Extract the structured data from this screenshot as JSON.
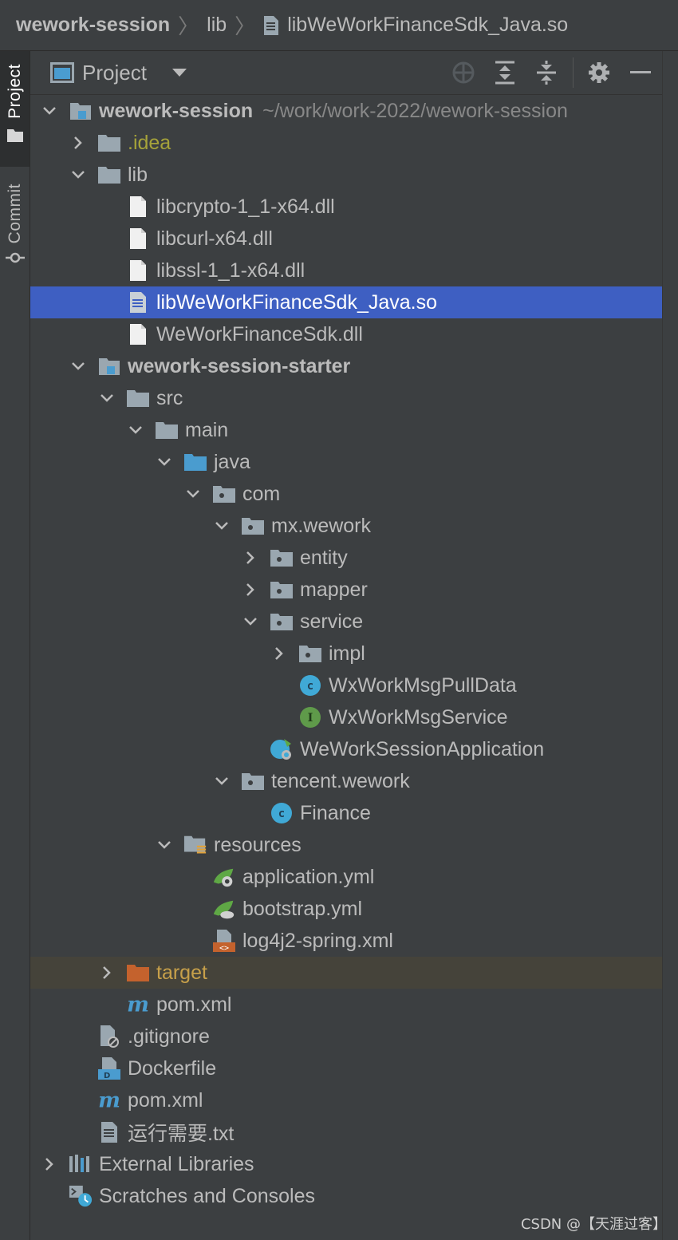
{
  "breadcrumb": {
    "root": "wework-session",
    "folder": "lib",
    "file": "libWeWorkFinanceSdk_Java.so"
  },
  "stripe": {
    "project_label": "Project",
    "commit_label": "Commit"
  },
  "panel": {
    "title": "Project",
    "dropdown_icon": "chevron-down-icon",
    "actions": [
      "locate-icon",
      "expand-all-icon",
      "collapse-all-icon",
      "gear-icon",
      "minimize-icon"
    ]
  },
  "tree": {
    "root": {
      "name": "wework-session",
      "path": "~/work/work-2022/wework-session"
    },
    "idea": ".idea",
    "lib": "lib",
    "lib_files": [
      "libcrypto-1_1-x64.dll",
      "libcurl-x64.dll",
      "libssl-1_1-x64.dll",
      "libWeWorkFinanceSdk_Java.so",
      "WeWorkFinanceSdk.dll"
    ],
    "starter": "wework-session-starter",
    "src": "src",
    "main": "main",
    "java": "java",
    "com": "com",
    "mx_wework": "mx.wework",
    "entity": "entity",
    "mapper": "mapper",
    "service": "service",
    "impl": "impl",
    "pull_data": "WxWorkMsgPullData",
    "msg_service": "WxWorkMsgService",
    "app": "WeWorkSessionApplication",
    "tencent_wework": "tencent.wework",
    "finance": "Finance",
    "resources": "resources",
    "app_yml": "application.yml",
    "bootstrap_yml": "bootstrap.yml",
    "log4j": "log4j2-spring.xml",
    "target": "target",
    "starter_pom": "pom.xml",
    "gitignore": ".gitignore",
    "dockerfile": "Dockerfile",
    "root_pom": "pom.xml",
    "txt": "运行需要.txt",
    "external_libraries": "External Libraries",
    "scratches": "Scratches and Consoles"
  },
  "watermark": "CSDN @【天涯过客】",
  "colors": {
    "background": "#3c3f41",
    "selection": "#3e5fc2",
    "excluded_row": "#45433a",
    "folder": "#9aa7b0",
    "source_folder": "#4a9ccf",
    "class_icon": "#40a9d6",
    "interface_icon": "#5f9a4a",
    "excluded_folder": "#c4622d"
  }
}
